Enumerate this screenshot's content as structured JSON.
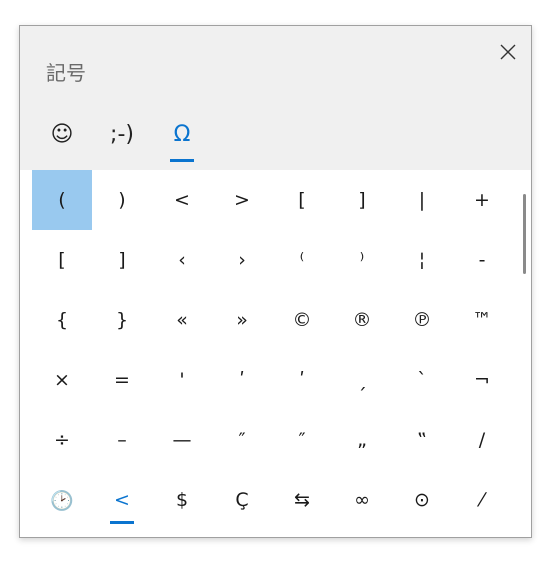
{
  "panel": {
    "title": "記号"
  },
  "tabs": [
    {
      "label": "☺",
      "name": "tab-emoji",
      "active": false
    },
    {
      "label": ";-)",
      "name": "tab-kaomoji",
      "active": false
    },
    {
      "label": "Ω",
      "name": "tab-symbols",
      "active": true
    }
  ],
  "grid": {
    "rows": [
      [
        "(",
        ")",
        "<",
        ">",
        "[",
        "]",
        "|",
        "+"
      ],
      [
        "[",
        "]",
        "‹",
        "›",
        "⁽",
        "⁾",
        "¦",
        "-"
      ],
      [
        "{",
        "}",
        "«",
        "»",
        "©",
        "®",
        "℗",
        "™"
      ],
      [
        "×",
        "=",
        "'",
        "ʹ",
        "ʹ",
        "ˏ",
        "ˋ",
        "¬"
      ],
      [
        "÷",
        "–",
        "—",
        "″",
        "″",
        "„",
        "‟",
        "/"
      ],
      [
        "🕑",
        "<",
        "$",
        "Ç",
        "⇆",
        "∞",
        "⊙",
        "⁄"
      ]
    ],
    "selected": [
      0,
      0
    ],
    "highlighted": [
      5,
      1
    ]
  },
  "colors": {
    "accent": "#0a74cf",
    "selected_bg": "#99c9ef",
    "header_bg": "#f0f0f0"
  }
}
